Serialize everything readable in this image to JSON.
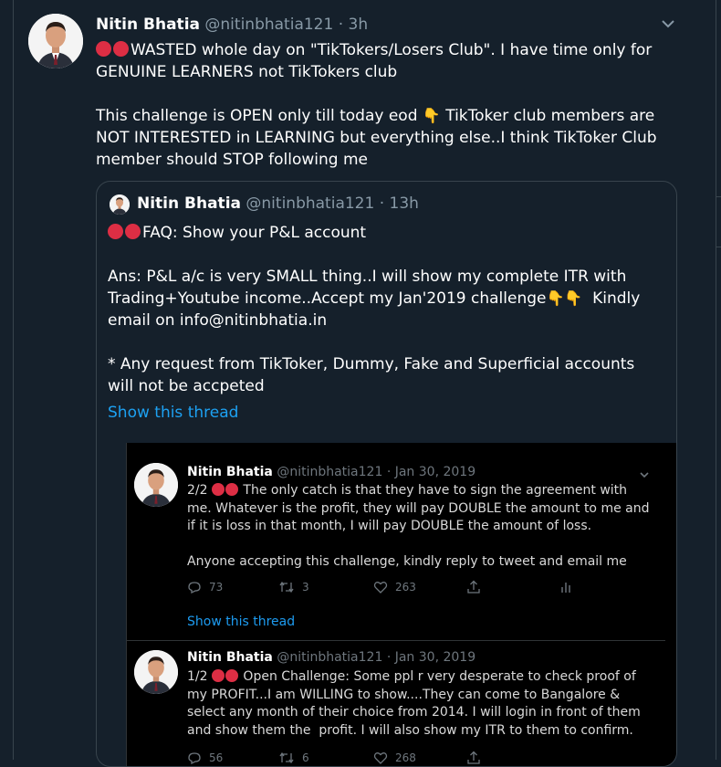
{
  "tweet": {
    "author_name": "Nitin Bhatia",
    "author_handle": "@nitinbhatia121",
    "time": "· 3h",
    "line1": "WASTED whole day on \"TikTokers/Losers Club\". I have time only for GENUINE LEARNERS not TikTokers club",
    "line2_a": "This challenge is OPEN only till today eod ",
    "line2_b": " TikToker club members are NOT INTERESTED in LEARNING but everything else..I think TikToker Club member should STOP following me",
    "emoji_hand": "👇"
  },
  "quote": {
    "author_name": "Nitin Bhatia",
    "author_handle": "@nitinbhatia121",
    "time": "· 13h",
    "faq": "FAQ: Show your P&L account",
    "ans_a": "Ans: P&L a/c is very SMALL thing..I will show my complete ITR with Trading+Youtube income..Accept my Jan'2019 challenge",
    "ans_b": "  Kindly email on info@nitinbhatia.in",
    "note": "* Any request from TikToker, Dummy, Fake and Superficial accounts will not be accpeted",
    "show_thread": "Show this thread"
  },
  "embedded": [
    {
      "author_name": "Nitin Bhatia",
      "author_handle": "@nitinbhatia121",
      "time": "· Jan 30, 2019",
      "prefix": "2/2 ",
      "text": " The only catch is that they have to sign the agreement with me. Whatever is the profit, they will pay DOUBLE the amount to me and if it is loss in that month, I will pay DOUBLE the amount of loss.",
      "text2": "Anyone accepting this challenge, kindly reply to tweet and email me",
      "replies": "73",
      "retweets": "3",
      "likes": "263",
      "show_thread": "Show this thread"
    },
    {
      "author_name": "Nitin Bhatia",
      "author_handle": "@nitinbhatia121",
      "time": "· Jan 30, 2019",
      "prefix": "1/2 ",
      "text": " Open Challenge: Some ppl r very desperate to check proof of my PROFIT...I am WILLING to show....They can come to Bangalore & select any month of their choice from 2014. I will login in front of them and show them the  profit. I will also show my ITR to them to confirm.",
      "replies": "56",
      "retweets": "6",
      "likes": "268"
    }
  ],
  "colors": {
    "background": "#15202b",
    "embed_background": "#000000",
    "link": "#1da1f2",
    "muted": "#8899a6",
    "red_dot": "#dd2e44"
  }
}
